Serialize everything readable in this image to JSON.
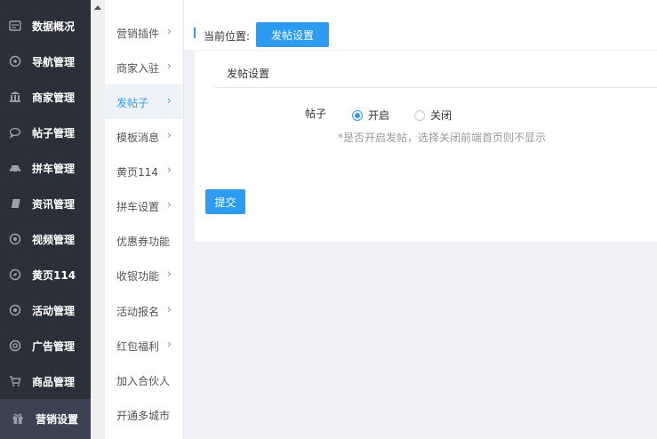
{
  "nav": {
    "items": [
      {
        "label": "数据概况",
        "icon": "dashboard-icon"
      },
      {
        "label": "导航管理",
        "icon": "compass-icon"
      },
      {
        "label": "商家管理",
        "icon": "bank-icon"
      },
      {
        "label": "帖子管理",
        "icon": "chat-bubble-icon"
      },
      {
        "label": "拼车管理",
        "icon": "car-icon"
      },
      {
        "label": "资讯管理",
        "icon": "book-icon"
      },
      {
        "label": "视频管理",
        "icon": "play-circle-icon"
      },
      {
        "label": "黄页114",
        "icon": "compass-icon"
      },
      {
        "label": "活动管理",
        "icon": "circle-icon"
      },
      {
        "label": "广告管理",
        "icon": "lifebuoy-icon"
      },
      {
        "label": "商品管理",
        "icon": "cart-icon"
      },
      {
        "label": "营销设置",
        "icon": "gift-icon"
      }
    ],
    "active_index": 11
  },
  "submenu": {
    "items": [
      {
        "label": "营销插件",
        "chevron": "›"
      },
      {
        "label": "商家入驻",
        "chevron": "›"
      },
      {
        "label": "发帖子",
        "chevron": "›"
      },
      {
        "label": "模板消息",
        "chevron": "›"
      },
      {
        "label": "黄页114",
        "chevron": "›"
      },
      {
        "label": "拼车设置",
        "chevron": "›"
      },
      {
        "label": "优惠券功能",
        "chevron": ""
      },
      {
        "label": "收银功能",
        "chevron": "›"
      },
      {
        "label": "活动报名",
        "chevron": "›"
      },
      {
        "label": "红包福利",
        "chevron": "›"
      },
      {
        "label": "加入合伙人",
        "chevron": ""
      },
      {
        "label": "开通多城市",
        "chevron": ""
      }
    ],
    "active_index": 2
  },
  "breadcrumb": {
    "label": "当前位置:",
    "current": "发帖设置"
  },
  "panel": {
    "title": "发帖设置",
    "field_label": "帖子",
    "options": [
      {
        "label": "开启",
        "checked": true
      },
      {
        "label": "关闭",
        "checked": false
      }
    ],
    "hint": "*是否开启发帖，选择关闭前端首页则不显示",
    "submit_label": "提交"
  },
  "colors": {
    "accent": "#2d9bf0",
    "nav_bg": "#2b2f3a",
    "nav_active_bg": "#3b4252"
  }
}
